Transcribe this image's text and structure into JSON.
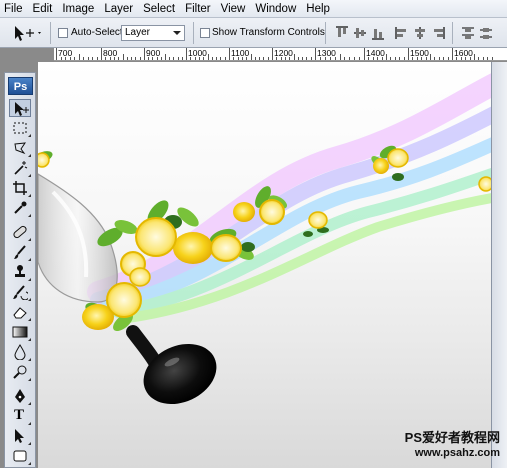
{
  "menu": [
    "File",
    "Edit",
    "Image",
    "Layer",
    "Select",
    "Filter",
    "View",
    "Window",
    "Help"
  ],
  "options": {
    "auto_select_label": "Auto-Select:",
    "auto_select_value": "Layer",
    "show_transform_label": "Show Transform Controls"
  },
  "ruler": {
    "labels": [
      "700",
      "800",
      "900",
      "1000",
      "1100",
      "1200",
      "1300",
      "1400",
      "1500",
      "1600"
    ]
  },
  "toolbox": {
    "logo": "Ps",
    "tools": [
      "move-tool",
      "marquee-tool",
      "lasso-tool",
      "magic-wand-tool",
      "crop-tool",
      "eyedropper-tool",
      "healing-brush-tool",
      "brush-tool",
      "clone-stamp-tool",
      "history-brush-tool",
      "eraser-tool",
      "gradient-tool",
      "blur-tool",
      "dodge-tool",
      "pen-tool",
      "type-tool",
      "path-selection-tool",
      "shape-tool"
    ],
    "type_glyph": "T"
  },
  "watermark": {
    "line1": "PS爱好者教程网",
    "line2": "www.psahz.com"
  },
  "colors": {
    "ui_bg": "#e3e8f0",
    "canvas_bg": "#ffffff",
    "lemon": "#f7d21a",
    "leaf": "#5fae2c",
    "rainbow": [
      "#e8a6ff",
      "#b7b4ff",
      "#9fd8ff",
      "#a8f0c8",
      "#b8f59a"
    ]
  }
}
